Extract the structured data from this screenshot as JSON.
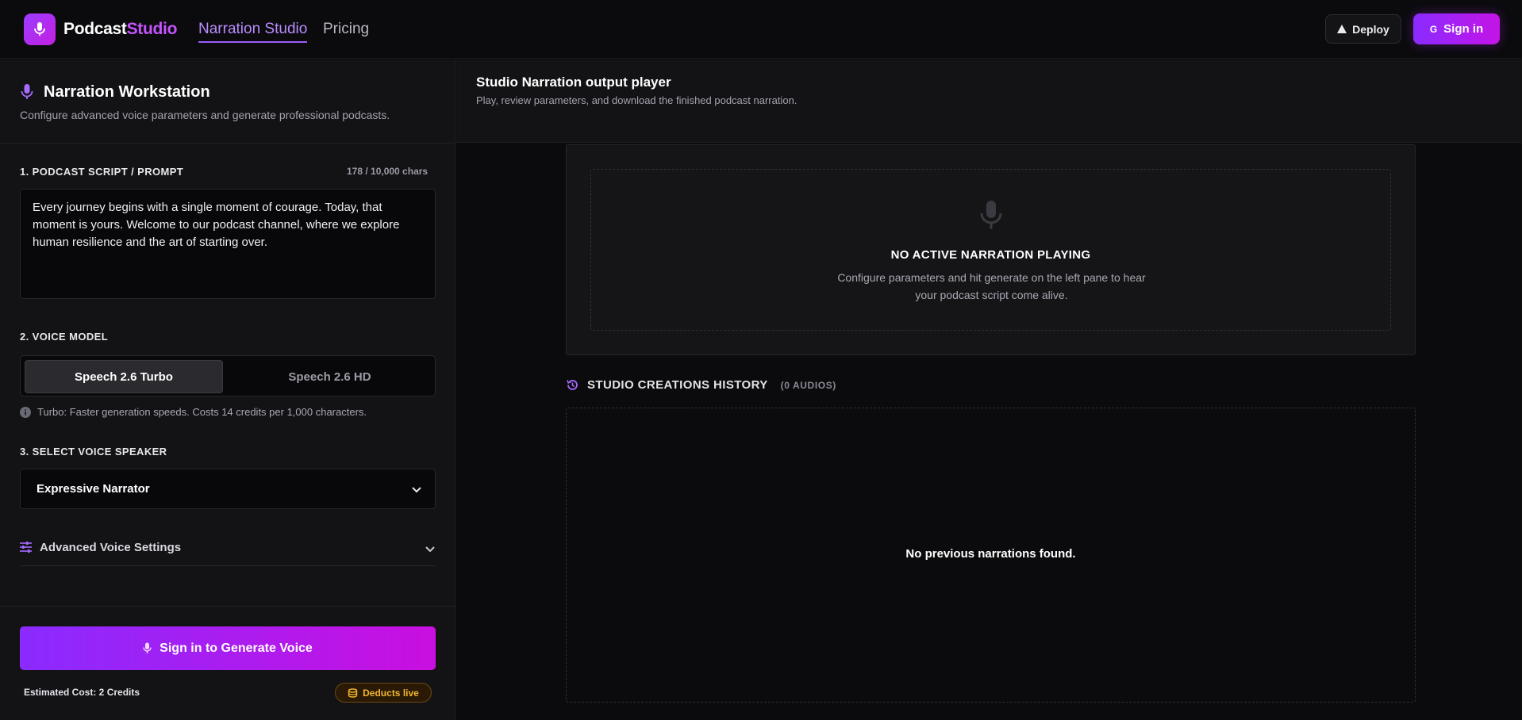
{
  "header": {
    "brand_part1": "Podcast",
    "brand_part2": "Studio",
    "nav": {
      "narration": "Narration Studio",
      "pricing": "Pricing"
    },
    "deploy_label": "Deploy",
    "signin_label": "Sign in"
  },
  "workstation": {
    "title": "Narration Workstation",
    "subtitle": "Configure advanced voice parameters and generate professional podcasts."
  },
  "script": {
    "label": "1. PODCAST SCRIPT / PROMPT",
    "char_count": "178 / 10,000 chars",
    "value": "Every journey begins with a single moment of courage. Today, that moment is yours. Welcome to our podcast channel, where we explore human resilience and the art of starting over."
  },
  "voice_model": {
    "label": "2. VOICE MODEL",
    "option_turbo": "Speech 2.6 Turbo",
    "option_hd": "Speech 2.6 HD",
    "selected": "Speech 2.6 Turbo",
    "info": "Turbo: Faster generation speeds. Costs 14 credits per 1,000 characters."
  },
  "speaker": {
    "label": "3. SELECT VOICE SPEAKER",
    "selected": "Expressive Narrator"
  },
  "advanced": {
    "label": "Advanced Voice Settings"
  },
  "footer": {
    "generate_label": "Sign in to Generate Voice",
    "estimated_cost": "Estimated Cost: 2 Credits",
    "deducts_badge": "Deducts live"
  },
  "player": {
    "title": "Studio Narration output player",
    "subtitle": "Play, review parameters, and download the finished podcast narration.",
    "empty_title": "NO ACTIVE NARRATION PLAYING",
    "empty_sub": "Configure parameters and hit generate on the left pane to hear your podcast script come alive."
  },
  "history": {
    "title": "STUDIO CREATIONS HISTORY",
    "count": "(0 AUDIOS)",
    "empty": "No previous narrations found."
  },
  "colors": {
    "accent": "#9c5cff",
    "brand_gradient_start": "#8a2bff",
    "brand_gradient_end": "#c90fe0",
    "badge_gold": "#f2b531"
  },
  "icons": [
    "mic-icon",
    "deploy-triangle-icon",
    "google-g-icon",
    "info-icon",
    "chevron-down-icon",
    "sliders-icon",
    "coins-icon",
    "history-icon"
  ]
}
